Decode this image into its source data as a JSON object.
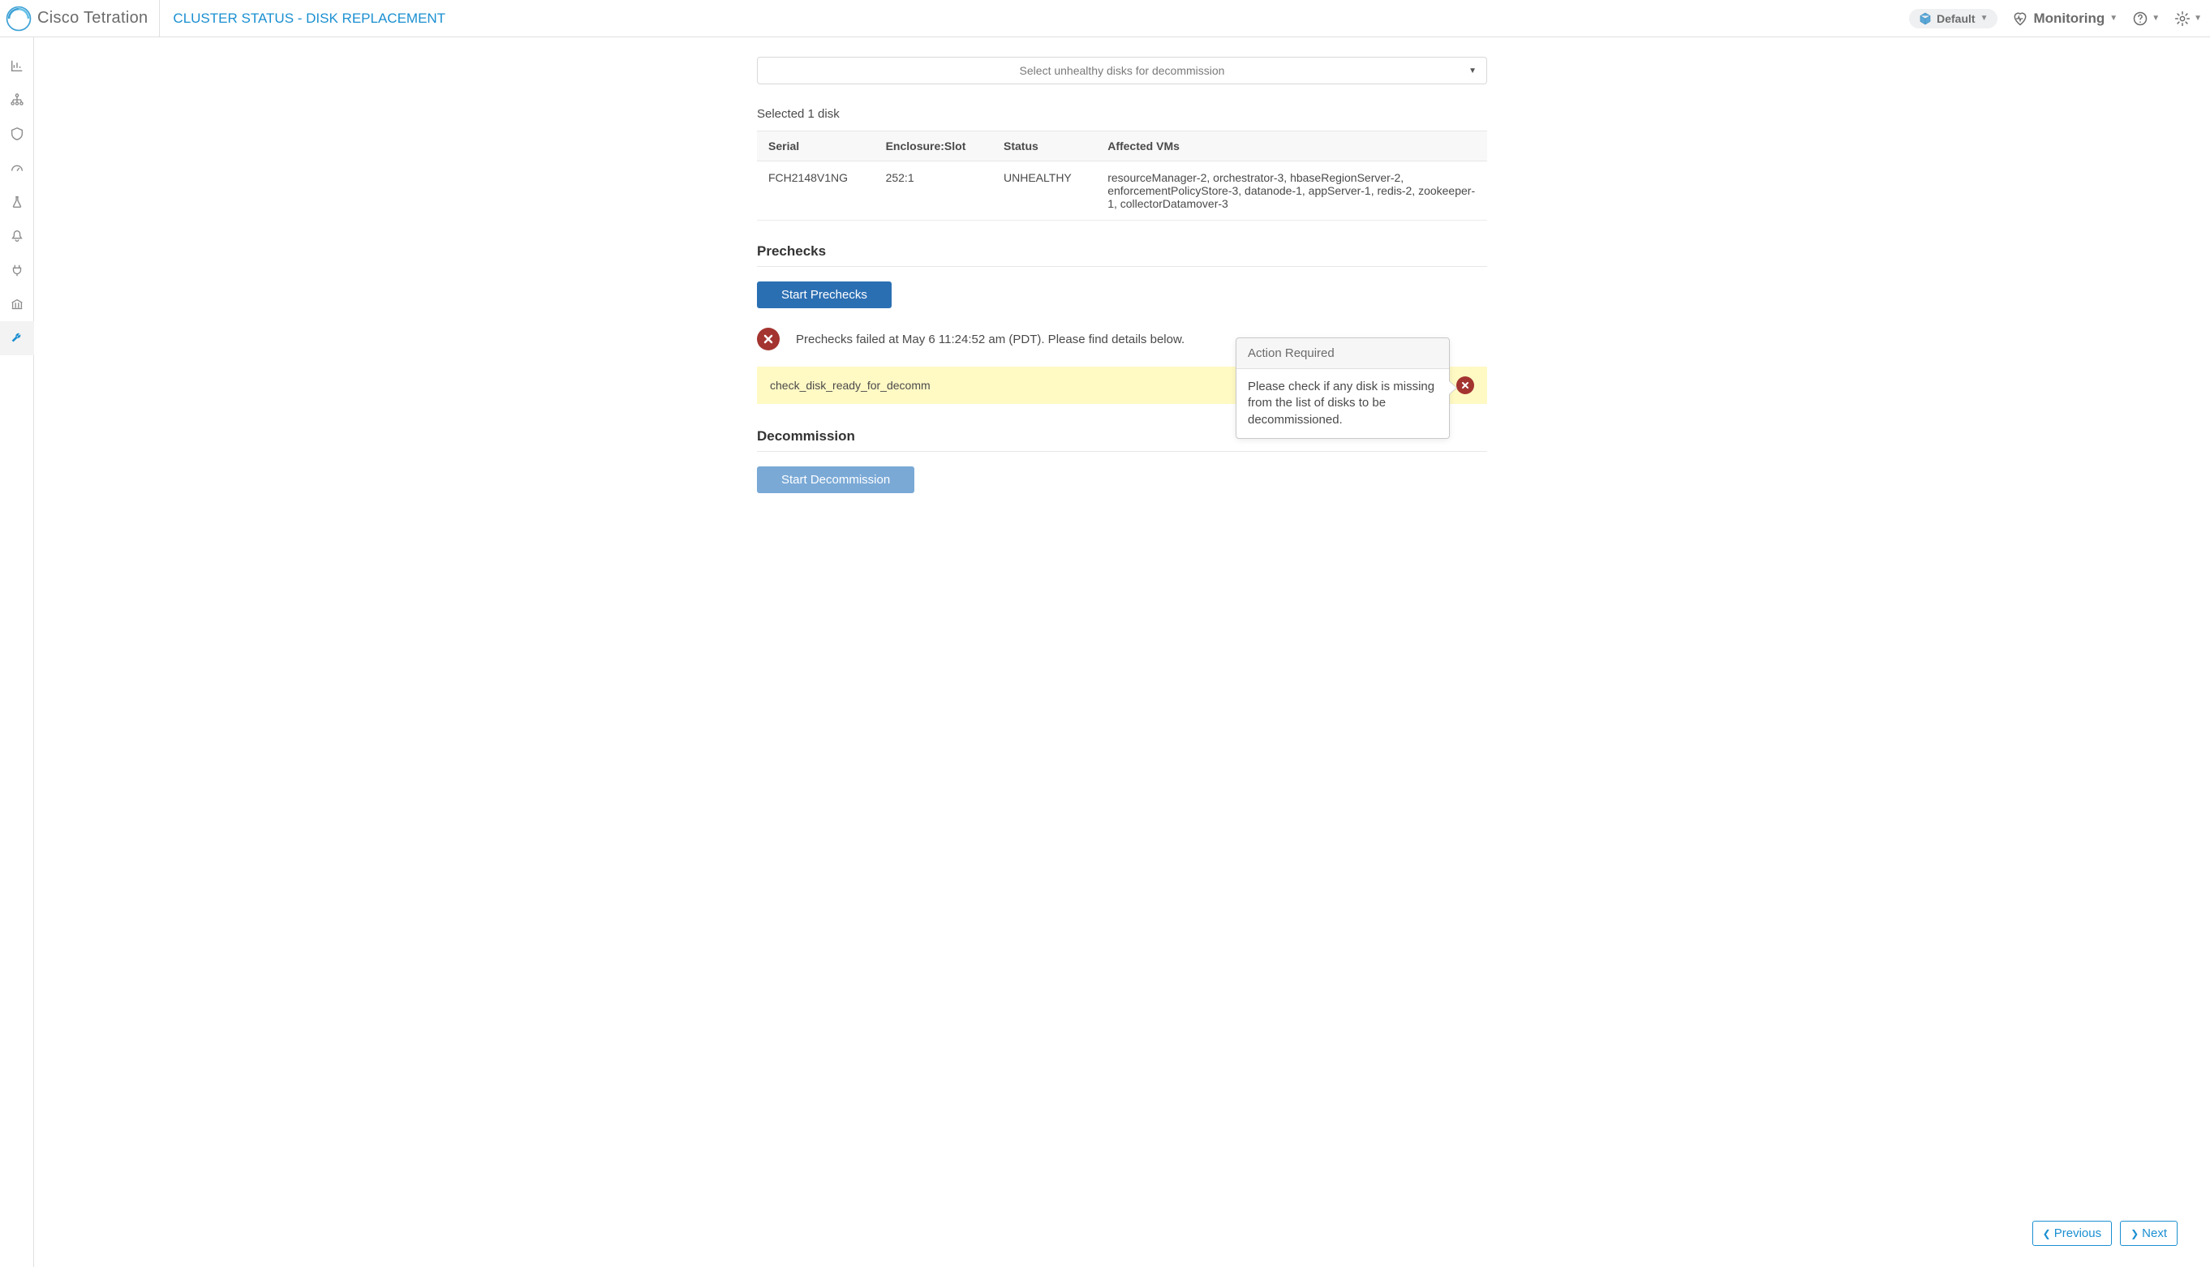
{
  "brand": "Cisco Tetration",
  "page_title": "CLUSTER STATUS - DISK REPLACEMENT",
  "scope_label": "Default",
  "monitoring_label": "Monitoring",
  "select_placeholder": "Select unhealthy disks for decommission",
  "selected_count": "Selected 1 disk",
  "table": {
    "headers": [
      "Serial",
      "Enclosure:Slot",
      "Status",
      "Affected VMs"
    ],
    "row": {
      "serial": "FCH2148V1NG",
      "slot": "252:1",
      "status": "UNHEALTHY",
      "affected": "resourceManager-2, orchestrator-3, hbaseRegionServer-2, enforcementPolicyStore-3, datanode-1, appServer-1, redis-2, zookeeper-1, collectorDatamover-3"
    }
  },
  "prechecks": {
    "heading": "Prechecks",
    "start_label": "Start Prechecks",
    "status_msg": "Prechecks failed at May 6 11:24:52 am (PDT). Please find details below.",
    "check_name": "check_disk_ready_for_decomm"
  },
  "popover": {
    "title": "Action Required",
    "body": "Please check if any disk is missing from the list of disks to be decommissioned."
  },
  "decommission": {
    "heading": "Decommission",
    "start_label": "Start Decommission"
  },
  "nav": {
    "prev": "Previous",
    "next": "Next"
  }
}
